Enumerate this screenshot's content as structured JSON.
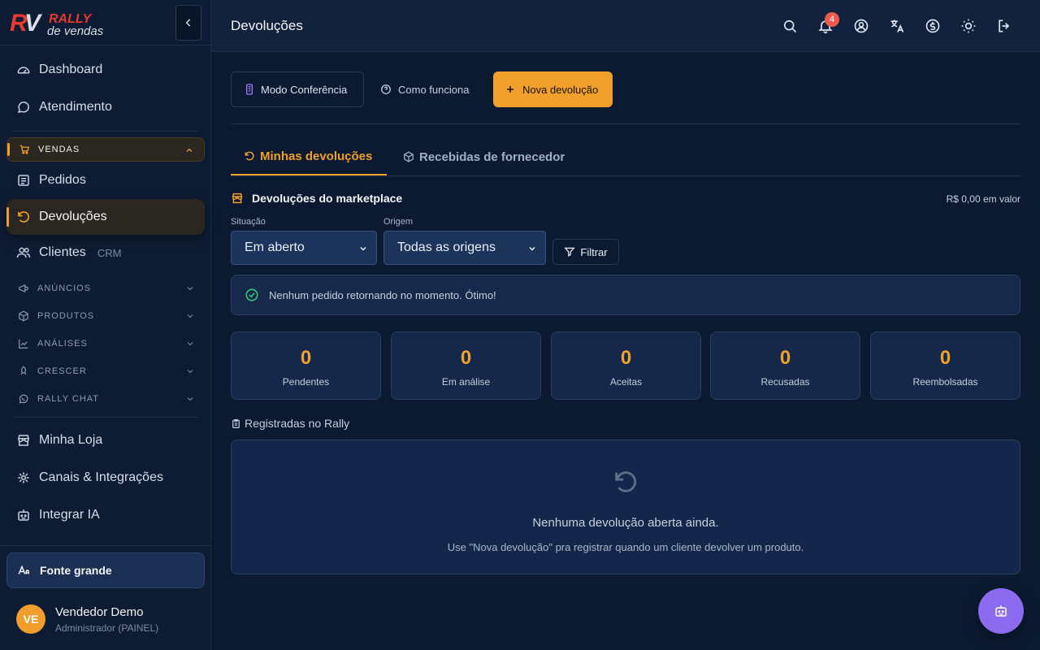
{
  "brand": {
    "name": "RALLY",
    "sub": "de vendas"
  },
  "sidebar": {
    "top_items": [
      {
        "label": "Dashboard"
      },
      {
        "label": "Atendimento"
      }
    ],
    "vendas_label": "VENDAS",
    "vendas_items": [
      {
        "label": "Pedidos"
      },
      {
        "label": "Devoluções"
      },
      {
        "label": "Clientes",
        "tag": "CRM"
      }
    ],
    "sections": [
      {
        "label": "ANÚNCIOS"
      },
      {
        "label": "PRODUTOS"
      },
      {
        "label": "ANÁLISES"
      },
      {
        "label": "CRESCER"
      },
      {
        "label": "RALLY CHAT"
      }
    ],
    "bottom_items": [
      {
        "label": "Minha Loja"
      },
      {
        "label": "Canais & Integrações"
      },
      {
        "label": "Integrar IA"
      }
    ],
    "font_button": "Fonte grande",
    "user": {
      "initials": "VE",
      "name": "Vendedor Demo",
      "role": "Administrador (PAINEL)"
    }
  },
  "header": {
    "title": "Devoluções",
    "notification_count": "4"
  },
  "actions": {
    "conferencia": "Modo Conferência",
    "como_funciona": "Como funciona",
    "nova": "Nova devolução"
  },
  "tabs": [
    {
      "label": "Minhas devoluções",
      "active": true
    },
    {
      "label": "Recebidas de fornecedor",
      "active": false
    }
  ],
  "marketplace": {
    "title": "Devoluções do marketplace",
    "value": "R$ 0,00 em valor"
  },
  "filters": {
    "situacao_label": "Situação",
    "situacao_value": "Em aberto",
    "origem_label": "Origem",
    "origem_value": "Todas as origens",
    "filter_button": "Filtrar"
  },
  "alert": "Nenhum pedido retornando no momento. Ótimo!",
  "stats": [
    {
      "value": "0",
      "label": "Pendentes"
    },
    {
      "value": "0",
      "label": "Em análise"
    },
    {
      "value": "0",
      "label": "Aceitas"
    },
    {
      "value": "0",
      "label": "Recusadas"
    },
    {
      "value": "0",
      "label": "Reembolsadas"
    }
  ],
  "registered": {
    "title": "Registradas no Rally",
    "empty_title": "Nenhuma devolução aberta ainda.",
    "empty_desc": "Use \"Nova devolução\" pra registrar quando um cliente devolver um produto."
  },
  "colors": {
    "accent": "#f0a02b",
    "background": "#0c1a31",
    "fab": "#8b6cf0"
  }
}
